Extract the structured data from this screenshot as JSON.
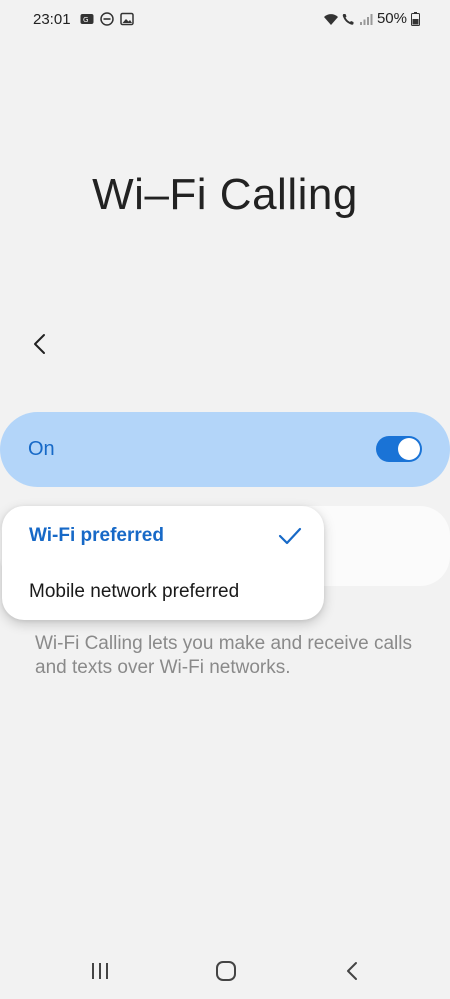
{
  "status_bar": {
    "time": "23:01",
    "battery_percent": "50%",
    "left_icons": [
      "data-saver-icon",
      "do-not-disturb-icon",
      "image-icon"
    ],
    "right_icons": [
      "wifi-icon",
      "wifi-call-icon",
      "signal-icon",
      "battery-icon"
    ]
  },
  "page": {
    "title": "Wi–Fi Calling"
  },
  "master_switch": {
    "label": "On",
    "state": true,
    "accent_color": "#1a73d6",
    "card_color": "#b3d5f9"
  },
  "preference_menu": {
    "options": [
      {
        "label": "Wi-Fi preferred",
        "selected": true
      },
      {
        "label": "Mobile network preferred",
        "selected": false
      }
    ],
    "selected_color": "#1769c7"
  },
  "description": "Wi-Fi Calling lets you make and receive calls and texts over Wi-Fi networks.",
  "nav_bar": {
    "buttons": [
      "recent-apps-icon",
      "home-icon",
      "back-icon"
    ]
  }
}
